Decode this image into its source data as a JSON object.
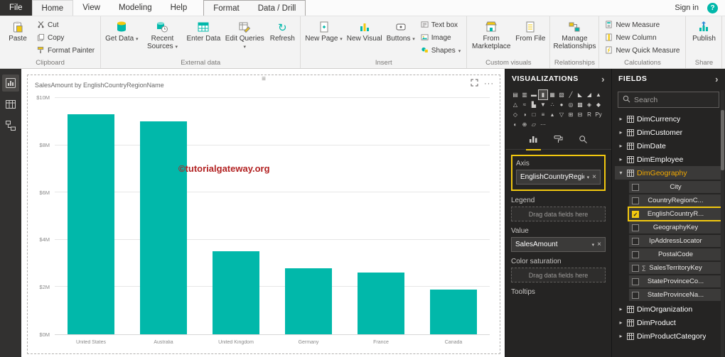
{
  "colors": {
    "accent": "#01b8aa",
    "highlight_yellow": "#f2c80f",
    "active_table_orange": "#f2a900",
    "watermark_red": "#b22222"
  },
  "titlebar": {
    "file_tab": "File",
    "tabs": [
      "Home",
      "View",
      "Modeling",
      "Help"
    ],
    "contextual_tabs": [
      "Format",
      "Data / Drill"
    ],
    "sign_in": "Sign in",
    "help_label": "?"
  },
  "ribbon": {
    "clipboard": {
      "label": "Clipboard",
      "paste": "Paste",
      "cut": "Cut",
      "copy": "Copy",
      "format_painter": "Format Painter"
    },
    "external_data": {
      "label": "External data",
      "get_data": "Get Data",
      "recent_sources": "Recent Sources",
      "enter_data": "Enter Data",
      "edit_queries": "Edit Queries",
      "refresh": "Refresh"
    },
    "insert": {
      "label": "Insert",
      "new_page": "New Page",
      "new_visual": "New Visual",
      "buttons": "Buttons",
      "text_box": "Text box",
      "image": "Image",
      "shapes": "Shapes"
    },
    "custom_visuals": {
      "label": "Custom visuals",
      "from_marketplace": "From Marketplace",
      "from_file": "From File"
    },
    "relationships": {
      "label": "Relationships",
      "manage_relationships": "Manage Relationships"
    },
    "calculations": {
      "label": "Calculations",
      "new_measure": "New Measure",
      "new_column": "New Column",
      "new_quick_measure": "New Quick Measure"
    },
    "share": {
      "label": "Share",
      "publish": "Publish"
    }
  },
  "canvas": {
    "watermark": "©tutorialgateway.org"
  },
  "chart_data": {
    "type": "bar",
    "title": "SalesAmount by EnglishCountryRegionName",
    "categories": [
      "United States",
      "Australia",
      "United Kingdom",
      "Germany",
      "France",
      "Canada"
    ],
    "values": [
      9.3,
      9.0,
      3.5,
      2.8,
      2.6,
      1.9
    ],
    "value_unit": "M",
    "ylim": [
      0,
      10
    ],
    "yticks": [
      {
        "value": 0,
        "label": "$0M"
      },
      {
        "value": 2,
        "label": "$2M"
      },
      {
        "value": 4,
        "label": "$4M"
      },
      {
        "value": 6,
        "label": "$6M"
      },
      {
        "value": 8,
        "label": "$8M"
      },
      {
        "value": 10,
        "label": "$10M"
      }
    ],
    "bar_color": "#01b8aa",
    "grid": true,
    "legend": "none",
    "xlabel": "",
    "ylabel": ""
  },
  "visualizations": {
    "header": "VISUALIZATIONS",
    "icons": [
      {
        "name": "stacked-bar-chart",
        "glyph": "▤"
      },
      {
        "name": "stacked-column-chart",
        "glyph": "▥"
      },
      {
        "name": "clustered-bar-chart",
        "glyph": "▬"
      },
      {
        "name": "clustered-column-chart",
        "glyph": "▮",
        "selected": true
      },
      {
        "name": "100-stacked-bar-chart",
        "glyph": "▦"
      },
      {
        "name": "100-stacked-column-chart",
        "glyph": "▧"
      },
      {
        "name": "line-chart",
        "glyph": "╱"
      },
      {
        "name": "area-chart",
        "glyph": "◣"
      },
      {
        "name": "stacked-area-chart",
        "glyph": "◢"
      },
      {
        "name": "line-and-stacked-column-chart",
        "glyph": "▲"
      },
      {
        "name": "line-and-clustered-column-chart",
        "glyph": "△"
      },
      {
        "name": "ribbon-chart",
        "glyph": "≈"
      },
      {
        "name": "waterfall-chart",
        "glyph": "▙"
      },
      {
        "name": "funnel-chart",
        "glyph": "▼"
      },
      {
        "name": "scatter-chart",
        "glyph": "∴"
      },
      {
        "name": "pie-chart",
        "glyph": "●"
      },
      {
        "name": "donut-chart",
        "glyph": "◎"
      },
      {
        "name": "treemap",
        "glyph": "▩"
      },
      {
        "name": "map",
        "glyph": "◈"
      },
      {
        "name": "filled-map",
        "glyph": "◆"
      },
      {
        "name": "shape-map",
        "glyph": "◇"
      },
      {
        "name": "gauge",
        "glyph": "◑"
      },
      {
        "name": "card",
        "glyph": "□"
      },
      {
        "name": "multi-row-card",
        "glyph": "≡"
      },
      {
        "name": "kpi",
        "glyph": "▴"
      },
      {
        "name": "slicer",
        "glyph": "▽"
      },
      {
        "name": "table",
        "glyph": "⊞"
      },
      {
        "name": "matrix",
        "glyph": "⊟"
      },
      {
        "name": "r-script-visual",
        "glyph": "R"
      },
      {
        "name": "python-visual",
        "glyph": "Py"
      },
      {
        "name": "key-influencers",
        "glyph": "◐"
      },
      {
        "name": "arcgis-map",
        "glyph": "⊕"
      },
      {
        "name": "power-apps",
        "glyph": "▱"
      },
      {
        "name": "get-more-visuals",
        "glyph": "⋯"
      }
    ],
    "wells": {
      "axis_label": "Axis",
      "axis_field": "EnglishCountryRegionN",
      "legend_label": "Legend",
      "legend_placeholder": "Drag data fields here",
      "value_label": "Value",
      "value_field": "SalesAmount",
      "color_saturation_label": "Color saturation",
      "color_saturation_placeholder": "Drag data fields here",
      "tooltips_label": "Tooltips"
    }
  },
  "fields": {
    "header": "FIELDS",
    "search_placeholder": "Search",
    "items": [
      {
        "kind": "table",
        "label": "DimCurrency",
        "expanded": false
      },
      {
        "kind": "table",
        "label": "DimCustomer",
        "expanded": false
      },
      {
        "kind": "table",
        "label": "DimDate",
        "expanded": false
      },
      {
        "kind": "table",
        "label": "DimEmployee",
        "expanded": false
      },
      {
        "kind": "table",
        "label": "DimGeography",
        "expanded": true,
        "active": true
      },
      {
        "kind": "field",
        "label": "City",
        "checked": false
      },
      {
        "kind": "field",
        "label": "CountryRegionC...",
        "checked": false
      },
      {
        "kind": "field",
        "label": "EnglishCountryR...",
        "checked": true,
        "highlighted": true
      },
      {
        "kind": "field",
        "label": "GeographyKey",
        "checked": false
      },
      {
        "kind": "field",
        "label": "IpAddressLocator",
        "checked": false
      },
      {
        "kind": "field",
        "label": "PostalCode",
        "checked": false
      },
      {
        "kind": "field",
        "label": "SalesTerritoryKey",
        "checked": false,
        "icon": "sigma"
      },
      {
        "kind": "field",
        "label": "StateProvinceCo...",
        "checked": false
      },
      {
        "kind": "field",
        "label": "StateProvinceNa...",
        "checked": false
      },
      {
        "kind": "table",
        "label": "DimOrganization",
        "expanded": false
      },
      {
        "kind": "table",
        "label": "DimProduct",
        "expanded": false
      },
      {
        "kind": "table",
        "label": "DimProductCategory",
        "expanded": false
      }
    ]
  }
}
